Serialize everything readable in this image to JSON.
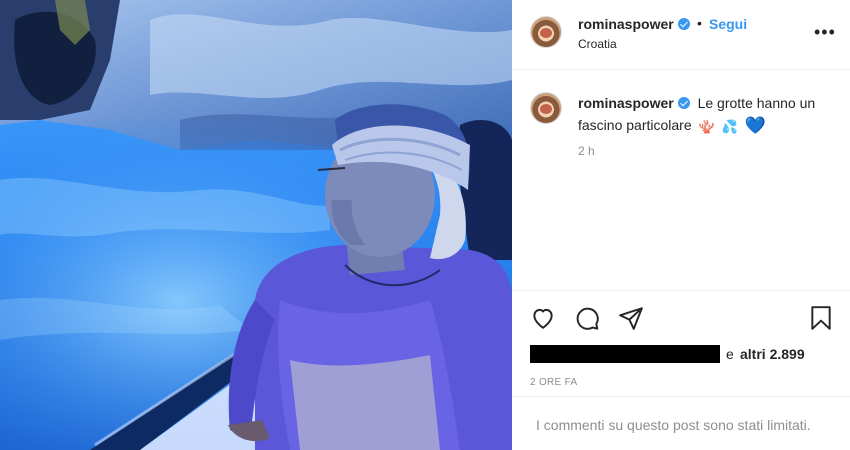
{
  "header": {
    "username": "rominaspower",
    "separator": "•",
    "follow_label": "Segui",
    "location": "Croatia",
    "more_label": "•••"
  },
  "caption": {
    "username": "rominaspower",
    "text": "Le grotte hanno un fascino particolare",
    "emojis": [
      "🪸",
      "💦",
      "💙"
    ],
    "time_ago": "2 h"
  },
  "actions": {
    "icons": [
      "heart-icon",
      "comment-icon",
      "share-icon",
      "bookmark-icon"
    ]
  },
  "likes": {
    "and_text": "e",
    "count_text": "altri 2.899"
  },
  "post_date": "2 ORE FA",
  "comments_notice": "I commenti su questo post sono stati limitati.",
  "colors": {
    "accent": "#3897f0",
    "muted": "#8e8e8e",
    "text": "#262626",
    "border": "#efefef"
  }
}
